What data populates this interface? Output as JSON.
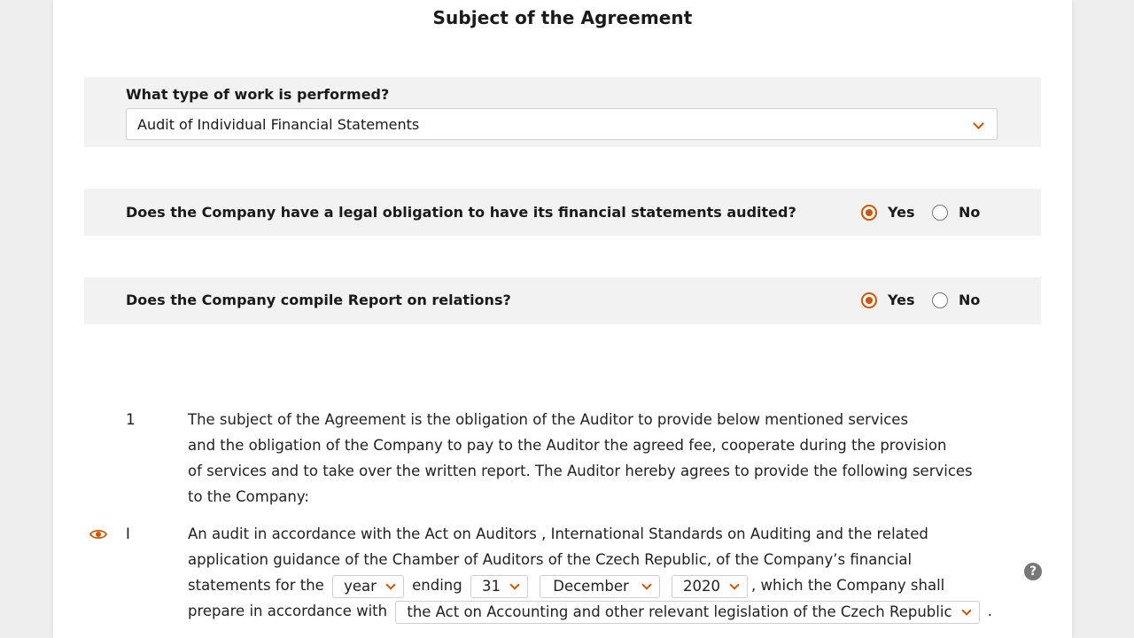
{
  "section_title": "Subject of the Agreement",
  "work_type": {
    "label": "What type of work is performed?",
    "selected": "Audit of Individual Financial Statements"
  },
  "legal_obligation": {
    "question": "Does the Company have a legal obligation to have its financial statements audited?",
    "yes_label": "Yes",
    "no_label": "No",
    "selected": "Yes"
  },
  "report_relations": {
    "question": "Does the Company compile Report on relations?",
    "yes_label": "Yes",
    "no_label": "No",
    "selected": "Yes"
  },
  "clause1": {
    "number": "1",
    "lines": [
      "The subject of the Agreement is the obligation of the Auditor to provide below mentioned services",
      "and the obligation of the  Company  to pay to the Auditor the agreed fee, cooperate during the provision",
      "of services and to take over the written report. The Auditor hereby agrees to provide the following services",
      "to the  Company:"
    ]
  },
  "clause_i": {
    "number": "I",
    "line1": "An audit  in accordance with the Act on Auditors , International Standards on Auditing  and the related",
    "line2": "application guidance of the Chamber of Auditors of the Czech Republic,  of  the Company’s financial",
    "line3_prefix": "statements  for the",
    "period_select": "year",
    "ending_text": "ending",
    "day_select": "31",
    "month_select": "December",
    "year_select": "2020",
    "line3_suffix": ", which the  Company  shall",
    "line4_prefix": "prepare in accordance with",
    "legislation_select": "the Act on Accounting and other relevant legislation of the Czech Republic",
    "line4_suffix": "."
  },
  "icons": {
    "visibility": "eye-icon",
    "help": "help-icon",
    "help_glyph": "?"
  },
  "colors": {
    "accent": "#d35400",
    "panel_bg": "#f2f2f2",
    "page_bg": "#ffffff"
  }
}
